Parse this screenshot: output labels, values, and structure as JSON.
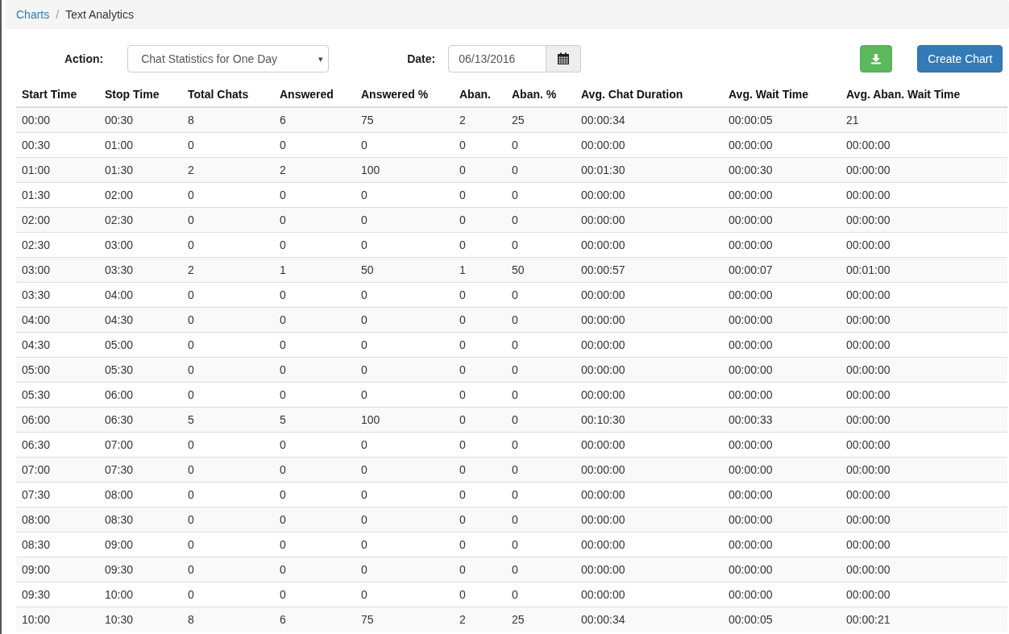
{
  "breadcrumb": [
    {
      "label": "Charts",
      "link": true
    },
    {
      "label": "Text Analytics",
      "link": false
    }
  ],
  "breadcrumb_separator": "/",
  "action": {
    "label": "Action:",
    "value": "Chat Statistics for One Day",
    "caret": "▾"
  },
  "date": {
    "label": "Date:",
    "value": "06/13/2016"
  },
  "buttons": [
    {
      "kind": "download"
    },
    {
      "kind": "text",
      "label": "Create Chart"
    }
  ],
  "table": {
    "columns": [
      "Start Time",
      "Stop Time",
      "Total Chats",
      "Answered",
      "Answered %",
      "Aban.",
      "Aban. %",
      "Avg. Chat Duration",
      "Avg. Wait Time",
      "Avg. Aban. Wait Time"
    ],
    "rows": [
      [
        "00:00",
        "00:30",
        "8",
        "6",
        "75",
        "2",
        "25",
        "00:00:34",
        "00:00:05",
        "21"
      ],
      [
        "00:30",
        "01:00",
        "0",
        "0",
        "0",
        "0",
        "0",
        "00:00:00",
        "00:00:00",
        "00:00:00"
      ],
      [
        "01:00",
        "01:30",
        "2",
        "2",
        "100",
        "0",
        "0",
        "00:01:30",
        "00:00:30",
        "00:00:00"
      ],
      [
        "01:30",
        "02:00",
        "0",
        "0",
        "0",
        "0",
        "0",
        "00:00:00",
        "00:00:00",
        "00:00:00"
      ],
      [
        "02:00",
        "02:30",
        "0",
        "0",
        "0",
        "0",
        "0",
        "00:00:00",
        "00:00:00",
        "00:00:00"
      ],
      [
        "02:30",
        "03:00",
        "0",
        "0",
        "0",
        "0",
        "0",
        "00:00:00",
        "00:00:00",
        "00:00:00"
      ],
      [
        "03:00",
        "03:30",
        "2",
        "1",
        "50",
        "1",
        "50",
        "00:00:57",
        "00:00:07",
        "00:01:00"
      ],
      [
        "03:30",
        "04:00",
        "0",
        "0",
        "0",
        "0",
        "0",
        "00:00:00",
        "00:00:00",
        "00:00:00"
      ],
      [
        "04:00",
        "04:30",
        "0",
        "0",
        "0",
        "0",
        "0",
        "00:00:00",
        "00:00:00",
        "00:00:00"
      ],
      [
        "04:30",
        "05:00",
        "0",
        "0",
        "0",
        "0",
        "0",
        "00:00:00",
        "00:00:00",
        "00:00:00"
      ],
      [
        "05:00",
        "05:30",
        "0",
        "0",
        "0",
        "0",
        "0",
        "00:00:00",
        "00:00:00",
        "00:00:00"
      ],
      [
        "05:30",
        "06:00",
        "0",
        "0",
        "0",
        "0",
        "0",
        "00:00:00",
        "00:00:00",
        "00:00:00"
      ],
      [
        "06:00",
        "06:30",
        "5",
        "5",
        "100",
        "0",
        "0",
        "00:10:30",
        "00:00:33",
        "00:00:00"
      ],
      [
        "06:30",
        "07:00",
        "0",
        "0",
        "0",
        "0",
        "0",
        "00:00:00",
        "00:00:00",
        "00:00:00"
      ],
      [
        "07:00",
        "07:30",
        "0",
        "0",
        "0",
        "0",
        "0",
        "00:00:00",
        "00:00:00",
        "00:00:00"
      ],
      [
        "07:30",
        "08:00",
        "0",
        "0",
        "0",
        "0",
        "0",
        "00:00:00",
        "00:00:00",
        "00:00:00"
      ],
      [
        "08:00",
        "08:30",
        "0",
        "0",
        "0",
        "0",
        "0",
        "00:00:00",
        "00:00:00",
        "00:00:00"
      ],
      [
        "08:30",
        "09:00",
        "0",
        "0",
        "0",
        "0",
        "0",
        "00:00:00",
        "00:00:00",
        "00:00:00"
      ],
      [
        "09:00",
        "09:30",
        "0",
        "0",
        "0",
        "0",
        "0",
        "00:00:00",
        "00:00:00",
        "00:00:00"
      ],
      [
        "09:30",
        "10:00",
        "0",
        "0",
        "0",
        "0",
        "0",
        "00:00:00",
        "00:00:00",
        "00:00:00"
      ],
      [
        "10:00",
        "10:30",
        "8",
        "6",
        "75",
        "2",
        "25",
        "00:00:34",
        "00:00:05",
        "00:00:21"
      ]
    ]
  }
}
